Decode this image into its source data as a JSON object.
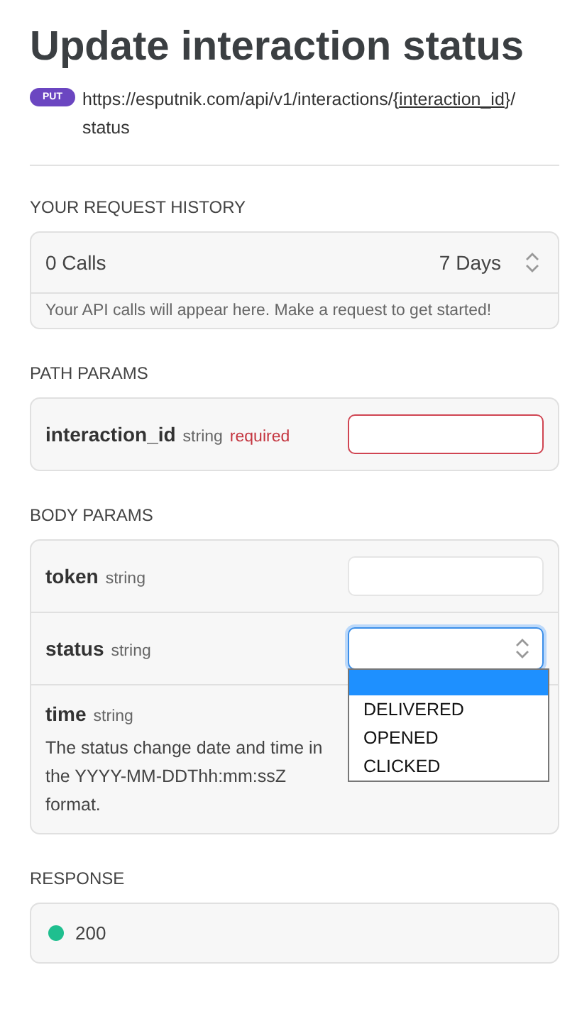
{
  "title": "Update interaction status",
  "endpoint": {
    "method": "PUT",
    "url_parts": [
      "https://esputnik.com/api/v1/interactions/{",
      "interaction_id",
      "}/",
      "status"
    ]
  },
  "history": {
    "heading": "YOUR REQUEST HISTORY",
    "calls": "0 Calls",
    "period": "7 Days",
    "note": "Your API calls will appear here. Make a request to get started!"
  },
  "path_params": {
    "heading": "PATH PARAMS",
    "params": [
      {
        "name": "interaction_id",
        "type": "string",
        "required_label": "required",
        "kind": "text",
        "invalid": true
      }
    ]
  },
  "body_params": {
    "heading": "BODY PARAMS",
    "params": [
      {
        "name": "token",
        "type": "string",
        "kind": "text",
        "invalid": false
      },
      {
        "name": "status",
        "type": "string",
        "kind": "select",
        "focused": true,
        "dropdown": {
          "blank_option_highlighted": true,
          "options": [
            {
              "label": "DELIVERED",
              "selected": false
            },
            {
              "label": "OPENED",
              "selected": false
            },
            {
              "label": "CLICKED",
              "selected": false
            }
          ]
        }
      },
      {
        "name": "time",
        "type": "string",
        "kind": "described",
        "description": "The status change date and time in the YYYY-MM-DDThh:mm:ssZ format."
      }
    ]
  },
  "response": {
    "heading": "RESPONSE",
    "code": "200",
    "color": "#1fbf8f"
  }
}
